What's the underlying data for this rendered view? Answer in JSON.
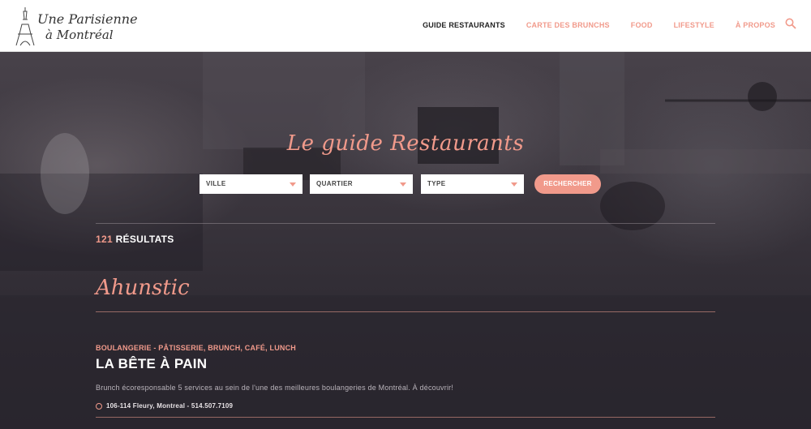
{
  "logo": {
    "line1": "Une Parisienne",
    "line2": "à Montréal"
  },
  "nav": [
    {
      "label": "GUIDE RESTAURANTS",
      "active": true
    },
    {
      "label": "CARTE DES BRUNCHS",
      "active": false
    },
    {
      "label": "FOOD",
      "active": false
    },
    {
      "label": "LIFESTYLE",
      "active": false
    },
    {
      "label": "À PROPOS",
      "active": false
    }
  ],
  "icons": {
    "search": "search-icon",
    "location": "location-pin-icon",
    "dropdown": "chevron-down-icon"
  },
  "colors": {
    "accent": "#f19a8b",
    "background": "#2e2a33",
    "header": "#ffffff"
  },
  "guide": {
    "title": "Le guide Restaurants"
  },
  "filters": {
    "ville": "VILLE",
    "quartier": "QUARTIER",
    "type": "TYPE",
    "search_button": "RECHERCHER"
  },
  "results": {
    "count": "121",
    "label": "RÉSULTATS"
  },
  "section": {
    "title": "Ahunstic"
  },
  "restaurant": {
    "categories": "BOULANGERIE - PÂTISSERIE, BRUNCH, CAFÉ, LUNCH",
    "name": "LA BÊTE À PAIN",
    "description": "Brunch écoresponsable 5 services au sein de l'une des meilleures boulangeries de Montréal. À découvrir!",
    "address": "106-114 Fleury, Montreal - 514.507.7109"
  }
}
